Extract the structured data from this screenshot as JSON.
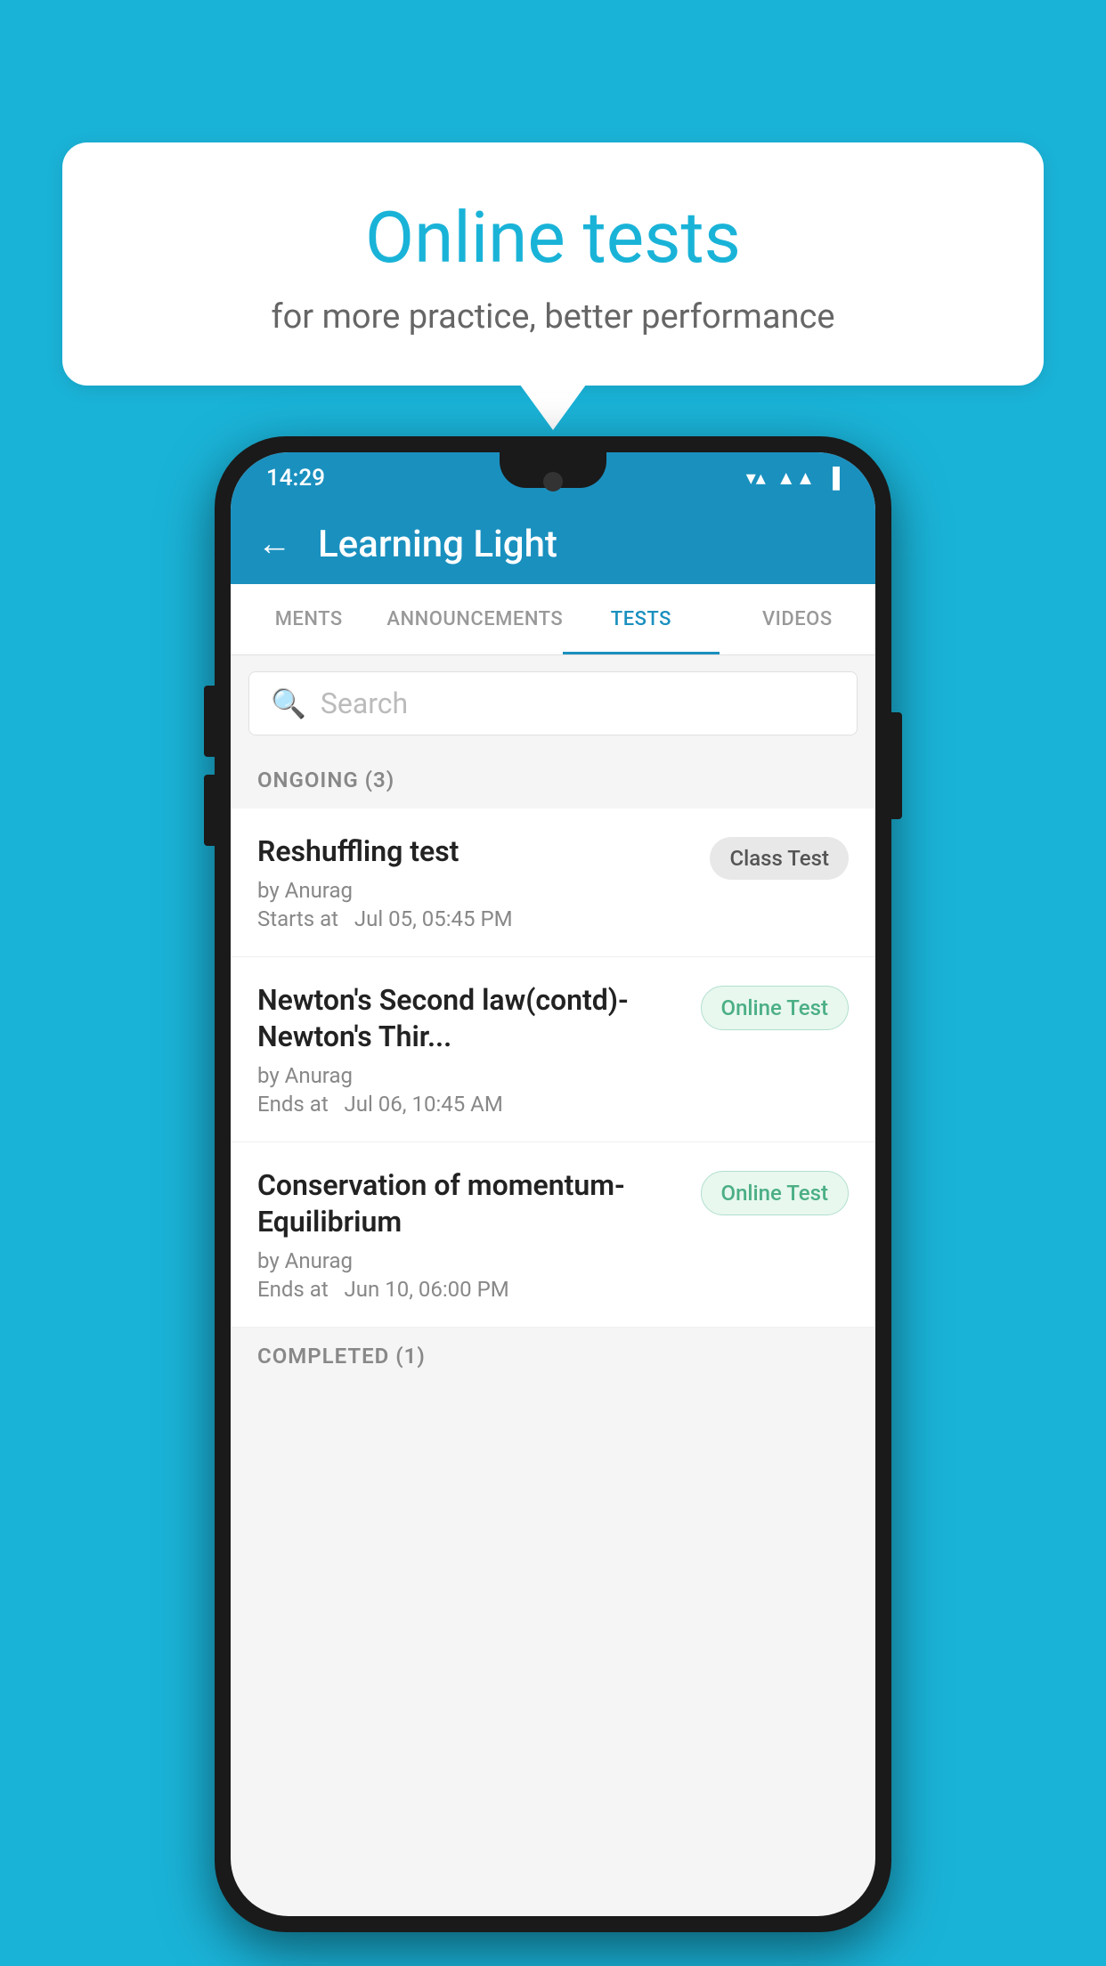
{
  "background_color": "#1ab3d8",
  "bubble": {
    "title": "Online tests",
    "subtitle": "for more practice, better performance"
  },
  "phone": {
    "status_bar": {
      "time": "14:29",
      "icons": [
        "wifi",
        "signal",
        "battery"
      ]
    },
    "header": {
      "title": "Learning Light",
      "back_label": "←"
    },
    "tabs": [
      {
        "label": "MENTS",
        "active": false
      },
      {
        "label": "ANNOUNCEMENTS",
        "active": false
      },
      {
        "label": "TESTS",
        "active": true
      },
      {
        "label": "VIDEOS",
        "active": false
      }
    ],
    "search": {
      "placeholder": "Search"
    },
    "ongoing_section": {
      "title": "ONGOING (3)",
      "tests": [
        {
          "name": "Reshuffling test",
          "author": "by Anurag",
          "time_label": "Starts at",
          "time": "Jul 05, 05:45 PM",
          "badge": "Class Test",
          "badge_type": "class"
        },
        {
          "name": "Newton's Second law(contd)-Newton's Thir...",
          "author": "by Anurag",
          "time_label": "Ends at",
          "time": "Jul 06, 10:45 AM",
          "badge": "Online Test",
          "badge_type": "online"
        },
        {
          "name": "Conservation of momentum-Equilibrium",
          "author": "by Anurag",
          "time_label": "Ends at",
          "time": "Jun 10, 06:00 PM",
          "badge": "Online Test",
          "badge_type": "online"
        }
      ]
    },
    "completed_section": {
      "title": "COMPLETED (1)"
    }
  }
}
